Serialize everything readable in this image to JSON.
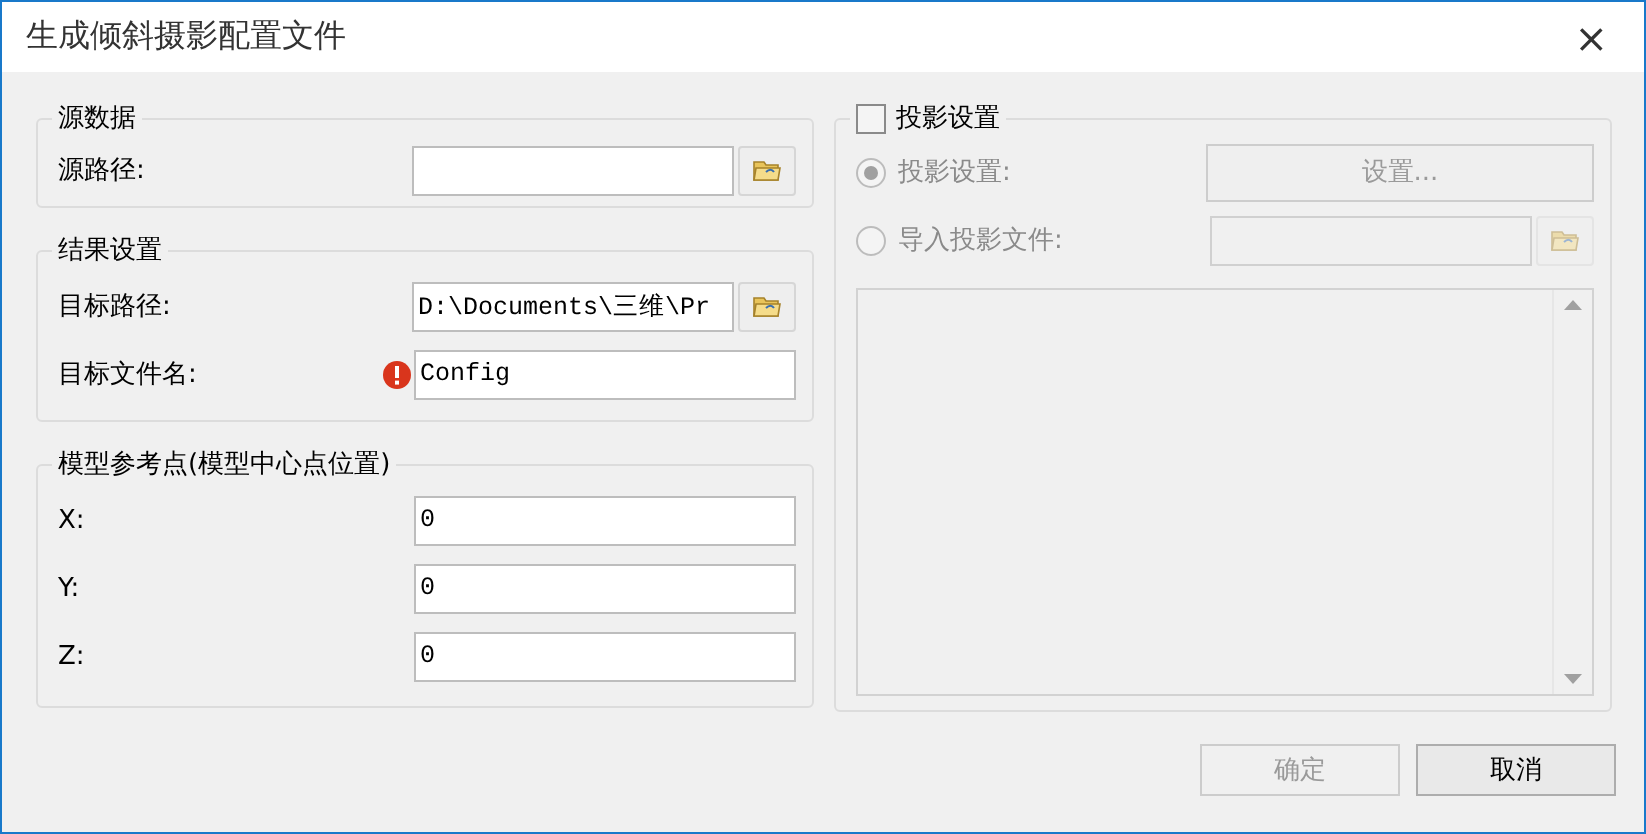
{
  "window": {
    "title": "生成倾斜摄影配置文件",
    "close": "×"
  },
  "groups": [
    {
      "title": "源数据",
      "rows": [
        {
          "label": "源路径:",
          "kind": "browse"
        }
      ]
    },
    {
      "title": "结果设置",
      "rows": [
        {
          "label": "目标路径:",
          "kind": "browse",
          "value": "D:\\Documents\\三维\\Pr"
        },
        {
          "label": "目标文件名:",
          "kind": "text",
          "value": "Config",
          "error": true
        }
      ]
    },
    {
      "title": "模型参考点(模型中心点位置)",
      "rows": [
        {
          "label": "X:",
          "kind": "text",
          "value": "0"
        },
        {
          "label": "Y:",
          "kind": "text",
          "value": "0"
        },
        {
          "label": "Z:",
          "kind": "text",
          "value": "0"
        }
      ]
    }
  ],
  "projection": {
    "title": "投影设置",
    "checked": false,
    "options": [
      {
        "label": "投影设置:",
        "selected": true,
        "disabled": true,
        "kind": "button",
        "button": "设置..."
      },
      {
        "label": "导入投影文件:",
        "selected": false,
        "disabled": true,
        "kind": "browse"
      }
    ]
  },
  "buttons": [
    {
      "label": "确定",
      "disabled": true
    },
    {
      "label": "取消",
      "disabled": false
    }
  ]
}
